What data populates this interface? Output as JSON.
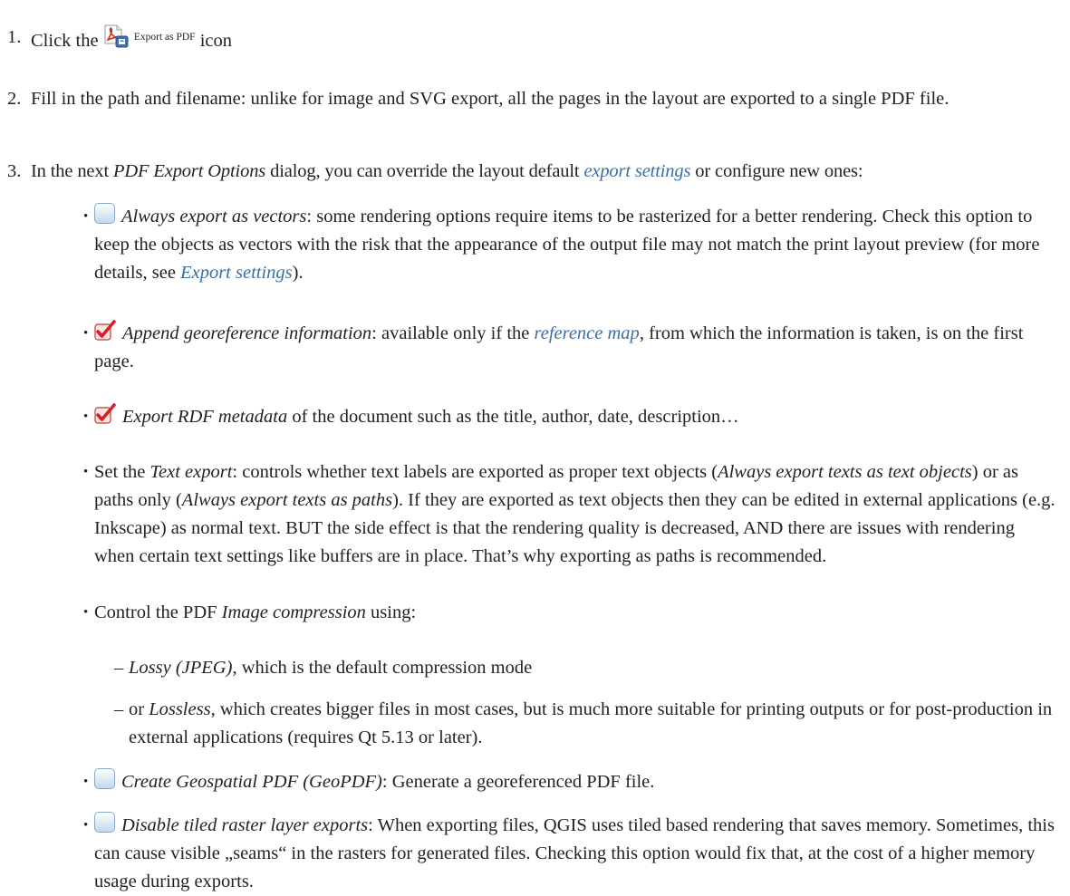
{
  "items": {
    "s1": {
      "num": "1.",
      "a": "Click the",
      "icon_label": "Export as PDF",
      "b": "icon"
    },
    "s2": {
      "num": "2.",
      "text": "Fill in the path and filename: unlike for image and SVG export, all the pages in the layout are exported to a single PDF file."
    },
    "s3": {
      "num": "3.",
      "a": "In the next ",
      "em": "PDF Export Options",
      "b": " dialog, you can override the layout default ",
      "link": "export settings",
      "c": " or configure new ones:"
    },
    "vectors": {
      "em": "Always export as vectors",
      "text": ": some rendering options require items to be rasterized for a better rendering. Check this option to keep the objects as vectors with the risk that the appearance of the output file may not match the print layout preview (for more details, see ",
      "link": "Export settings",
      "end": ")."
    },
    "georef": {
      "em": "Append georeference information",
      "a": ": available only if the ",
      "link": "reference map",
      "b": ", from which the information is taken, is on the first page."
    },
    "rdf": {
      "em": "Export RDF metadata",
      "text": " of the document such as the title, author, date, description…"
    },
    "textexport": {
      "a": "Set the ",
      "em1": "Text export",
      "b": ": controls whether text labels are exported as proper text objects (",
      "em2": "Always export texts as text objects",
      "c": ") or as paths only (",
      "em3": "Always export texts as paths",
      "d": "). If they are exported as text objects then they can be edited in external applications (e.g. Inkscape) as normal text. BUT the side effect is that the rendering quality is decreased, AND there are issues with rendering when certain text settings like buffers are in place. That’s why exporting as paths is recommended."
    },
    "compression": {
      "a": "Control the PDF ",
      "em": "Image compression",
      "b": " using:"
    },
    "lossy": {
      "em": "Lossy (JPEG)",
      "text": ", which is the default compression mode"
    },
    "lossless": {
      "a": "or ",
      "em": "Lossless",
      "b": ", which creates bigger files in most cases, but is much more suitable for printing outputs or for post-production in external applications (requires Qt 5.13 or later)."
    },
    "geopdf": {
      "em": "Create Geospatial PDF (GeoPDF)",
      "text": ": Generate a georeferenced PDF file."
    },
    "tiled": {
      "em": "Disable tiled raster layer exports",
      "text": ": When exporting files, QGIS uses tiled based rendering that saves memory. Sometimes, this can cause visible „seams“ in the rasters for generated files. Checking this option would fix that, at the cost of a higher memory usage during exports."
    }
  },
  "bullet": "•",
  "dash": "–",
  "checkboxes": {
    "vectors": false,
    "georef": true,
    "rdf": true,
    "geopdf": false,
    "tiled": false
  },
  "colors": {
    "link": "#3a6ea5",
    "text": "#222222",
    "check_red": "#d4202a"
  }
}
